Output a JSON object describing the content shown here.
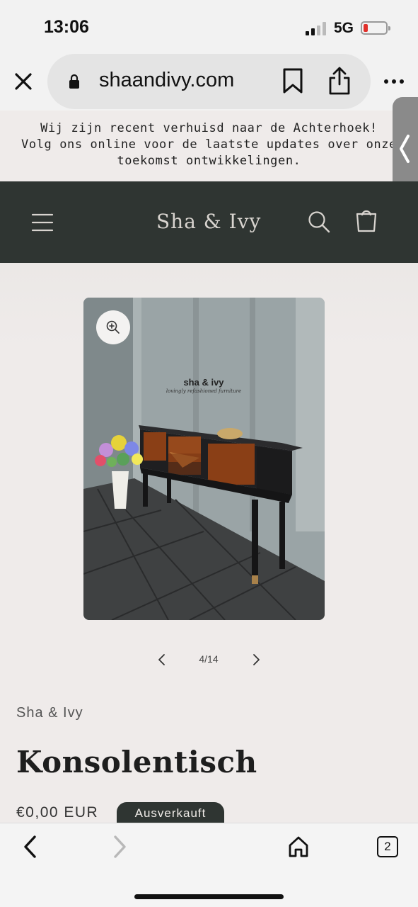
{
  "status": {
    "time": "13:06",
    "network": "5G"
  },
  "browser": {
    "url": "shaandivy.com",
    "tab_count": "2"
  },
  "announcement": {
    "line1": "Wij zijn recent verhuisd naar de Achterhoek!",
    "line2": "Volg ons online voor de laatste updates over onze",
    "line3": "toekomst ontwikkelingen."
  },
  "header": {
    "logo": "Sha & Ivy"
  },
  "gallery": {
    "counter": "4/14",
    "watermark_brand": "sha & ivy",
    "watermark_tagline": "lovingly refashioned furniture"
  },
  "product": {
    "vendor": "Sha & Ivy",
    "title": "Konsolentisch",
    "price": "€0,00 EUR",
    "badge": "Ausverkauft"
  },
  "colors": {
    "header_bg": "#2f3532",
    "page_bg": "#efebea",
    "battery_low": "#e0302a"
  },
  "icons": [
    "close-icon",
    "lock-icon",
    "bookmark-icon",
    "share-icon",
    "more-icon",
    "menu-icon",
    "search-icon",
    "cart-icon",
    "zoom-icon",
    "chevron-left-icon",
    "chevron-right-icon",
    "back-icon",
    "forward-icon",
    "home-icon",
    "tabs-icon"
  ]
}
